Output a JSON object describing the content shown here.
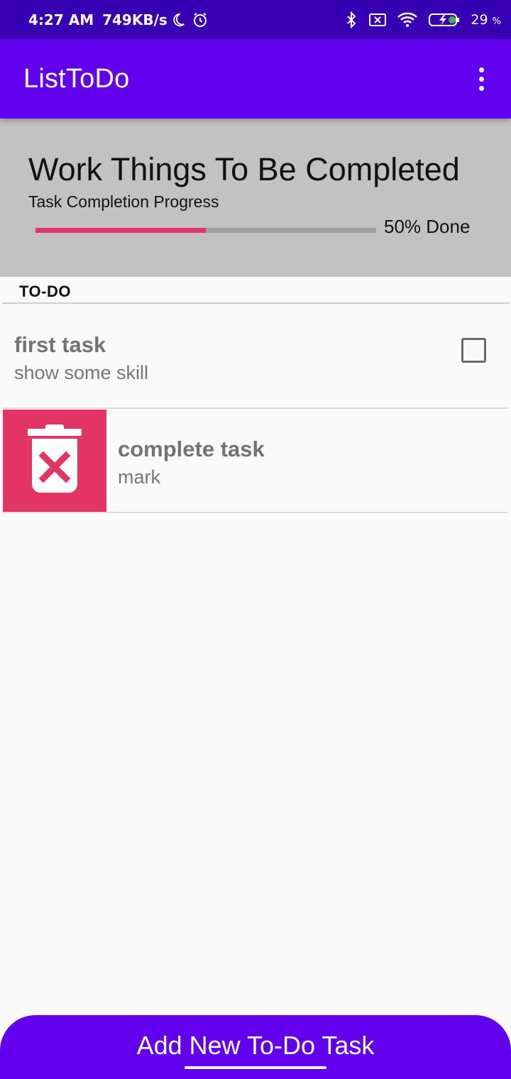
{
  "status_bar": {
    "time": "4:27 AM",
    "net_speed": "749KB/s",
    "battery_pct": "29",
    "battery_unit": "%",
    "icons": [
      "moon-icon",
      "alarm-icon",
      "bluetooth-icon",
      "sim-off-icon",
      "wifi-icon",
      "battery-charging-icon"
    ]
  },
  "app_bar": {
    "title": "ListToDo",
    "overflow_icon": "more-vert-icon"
  },
  "progress_card": {
    "title": "Work Things To Be Completed",
    "subtitle": "Task Completion Progress",
    "progress_fraction": 0.5,
    "progress_label": "50% Done",
    "colors": {
      "card_bg": "#c2c2c2",
      "fill": "#e0356a",
      "track": "#9e9e9e"
    }
  },
  "section": {
    "title": "TO-DO"
  },
  "tasks": [
    {
      "name": "first task",
      "description": "show some skill",
      "checked": false
    },
    {
      "name": "complete task",
      "description": "mark",
      "swipe_action": "delete-icon"
    }
  ],
  "bottom_button": {
    "label": "Add New To-Do Task"
  },
  "colors": {
    "primary": "#6200ee",
    "primary_dark": "#3700b3",
    "accent": "#e23563"
  }
}
